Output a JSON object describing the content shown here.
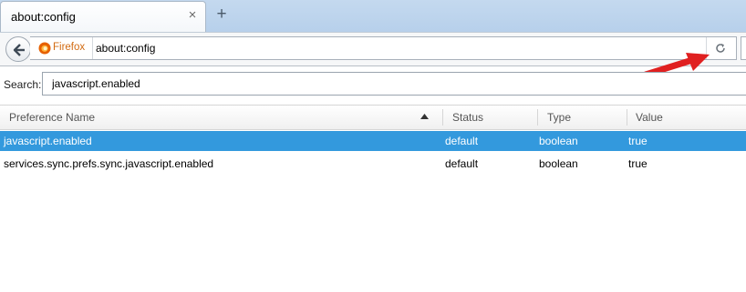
{
  "tab": {
    "title": "about:config",
    "close_glyph": "×",
    "new_tab_glyph": "+"
  },
  "navbar": {
    "identity_label": "Firefox",
    "url": "about:config"
  },
  "search": {
    "label": "Search:",
    "value": "javascript.enabled"
  },
  "columns": {
    "name": "Preference Name",
    "status": "Status",
    "type": "Type",
    "value": "Value"
  },
  "rows": [
    {
      "name": "javascript.enabled",
      "status": "default",
      "type": "boolean",
      "value": "true"
    },
    {
      "name": "services.sync.prefs.sync.javascript.enabled",
      "status": "default",
      "type": "boolean",
      "value": "true"
    }
  ],
  "colors": {
    "selection": "#3399dd",
    "identity_text": "#d26b12",
    "annotation_arrow": "#e02020"
  }
}
